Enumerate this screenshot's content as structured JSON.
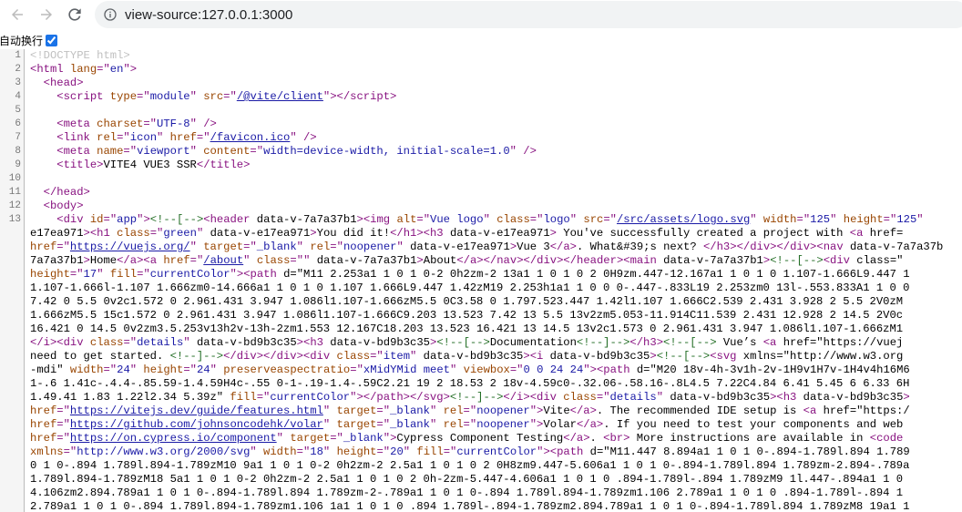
{
  "browser": {
    "back_icon": "arrow-left-icon",
    "forward_icon": "arrow-right-icon",
    "reload_icon": "reload-icon",
    "info_icon": "info-circle-icon",
    "url": "view-source:127.0.0.1:3000"
  },
  "wrap": {
    "label": "自动换行",
    "checked": true
  },
  "source": {
    "line_numbers": [
      "1",
      "2",
      "3",
      "4",
      "5",
      "6",
      "7",
      "8",
      "9",
      "10",
      "11",
      "12",
      "13",
      "",
      "",
      "",
      "",
      "",
      "",
      "",
      "",
      "",
      "",
      "",
      "",
      "",
      "",
      "",
      "",
      "",
      "",
      "",
      "",
      ""
    ],
    "l1": "<!DOCTYPE html>",
    "l5_src": "/@vite/client",
    "l7_href": "/favicon.ico",
    "l9_title": "VITE4 VUE3 SSR",
    "line13_rows": [
      "<div id=\"app\"><!--[--><header data-v-7a7a37b1><img alt=\"Vue logo\" class=\"logo\" src=\"/src/assets/logo.svg\" width=\"125\" height=\"125\"",
      "e17ea971><h1 class=\"green\" data-v-e17ea971>You did it!</h1><h3 data-v-e17ea971> You've successfully created a project with <a href=",
      "href=\"https://vuejs.org/\" target=\"_blank\" rel=\"noopener\" data-v-e17ea971>Vue 3</a>. What&#39;s next? </h3></div></div><nav data-v-7a7a37b",
      "7a7a37b1>Home</a><a href=\"/about\" class=\"\" data-v-7a7a37b1>About</a></nav></div></header><main data-v-7a7a37b1><!--[--><div class=\"",
      "height=\"17\" fill=\"currentColor\"><path d=\"M11 2.253a1 1 0 1 0-2 0h2zm-2 13a1 1 0 1 0 2 0H9zm.447-12.167a1 1 0 1 0 1.107-1.666L9.447 1",
      "1.107-1.666l-1.107 1.666zm0-14.666a1 1 0 1 0 1.107 1.666L9.447 1.42zM19 2.253h1a1 1 0 0 0-.447-.833L19 2.253zm0 13l-.553.833A1 1 0 0",
      "7.42 0 5.5 0v2c1.572 0 2.961.431 3.947 1.086l1.107-1.666zM5.5 0C3.58 0 1.797.523.447 1.42l1.107 1.666C2.539 2.431 3.928 2 5.5 2V0zM",
      "1.666zM5.5 15c1.572 0 2.961.431 3.947 1.086l1.107-1.666C9.203 13.523 7.42 13 5.5 13v2zm5.053-11.914C11.539 2.431 12.928 2 14.5 2V0c",
      "16.421 0 14.5 0v2zm3.5.253v13h2v-13h-2zm1.553 12.167C18.203 13.523 16.421 13 14.5 13v2c1.573 0 2.961.431 3.947 1.086l1.107-1.666zM1",
      "</i><div class=\"details\" data-v-bd9b3c35><h3 data-v-bd9b3c35><!--[-->Documentation<!--]--></h3><!--[--> Vue’s <a href=\"https://vuej",
      "need to get started. <!--]--></div></div><div class=\"item\" data-v-bd9b3c35><i data-v-bd9b3c35><!--[--><svg xmlns=\"http://www.w3.org",
      "-mdi\" width=\"24\" height=\"24\" preserveaspectratio=\"xMidYMid meet\" viewbox=\"0 0 24 24\"><path d=\"M20 18v-4h-3v1h-2v-1H9v1H7v-1H4v4h16M6",
      "1-.6 1.41c-.4.4-.85.59-1.4.59H4c-.55 0-1-.19-1.4-.59C2.21 19 2 18.53 2 18v-4.59c0-.32.06-.58.16-.8L4.5 7.22C4.84 6.41 5.45 6 6.33 6H",
      "1.49.41 1.83 1.22l2.34 5.39z\" fill=\"currentColor\"></path></svg><!--]--></i><div class=\"details\" data-v-bd9b3c35><h3 data-v-bd9b3c35>",
      "href=\"https://vitejs.dev/guide/features.html\" target=\"_blank\" rel=\"noopener\">Vite</a>. The recommended IDE setup is <a href=\"https:/",
      "href=\"https://github.com/johnsoncodehk/volar\" target=\"_blank\" rel=\"noopener\">Volar</a>. If you need to test your components and web",
      "href=\"https://on.cypress.io/component\" target=\"_blank\">Cypress Component Testing</a>. <br> More instructions are available in <code",
      "xmlns=\"http://www.w3.org/2000/svg\" width=\"18\" height=\"20\" fill=\"currentColor\"><path d=\"M11.447 8.894a1 1 0 1 0-.894-1.789l.894 1.789",
      "0 1 0-.894 1.789l.894-1.789zM10 9a1 1 0 1 0-2 0h2zm-2 2.5a1 1 0 1 0 2 0H8zm9.447-5.606a1 1 0 1 0-.894-1.789l.894 1.789zm-2.894-.789a",
      "1.789l.894-1.789zM18 5a1 1 0 1 0-2 0h2zm-2 2.5a1 1 0 1 0 2 0h-2zm-5.447-4.606a1 1 0 1 0 .894-1.789l-.894 1.789zM9 1l.447-.894a1 1 0",
      "4.106zm2.894.789a1 1 0 1 0-.894-1.789l.894 1.789zm-2-.789a1 1 0 1 0-.894 1.789l.894-1.789zm1.106 2.789a1 1 0 1 0 .894-1.789l-.894 1",
      "2.789a1 1 0 1 0-.894 1.789l.894-1.789zm1.106 1a1 1 0 1 0 .894 1.789l-.894-1.789zm2.894.789a1 1 0 1 0-.894-1.789l.894 1.789zM8 19a1 1"
    ]
  },
  "colors": {
    "tag": "#881280",
    "attr_name": "#994500",
    "attr_value": "#1a1aa6",
    "comment": "#236e25",
    "gutter_bg": "#f5f5f5"
  }
}
